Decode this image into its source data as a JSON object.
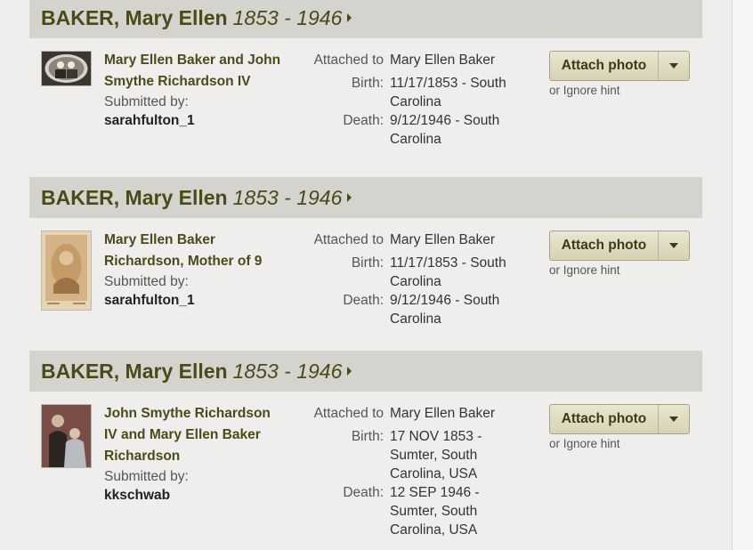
{
  "records": [
    {
      "name": "BAKER, Mary Ellen",
      "dates": "1853 - 1946",
      "photo_title": "Mary Ellen Baker and John Smythe Richardson IV",
      "submitted_label": "Submitted by:",
      "submitter": "sarahfulton_1",
      "attached_label": "Attached to",
      "attached_to": "Mary Ellen Baker",
      "birth_label": "Birth:",
      "birth": "11/17/1853 - South Carolina",
      "death_label": "Death:",
      "death": "9/12/1946 - South Carolina",
      "attach_button": "Attach photo",
      "ignore_link": "or Ignore hint"
    },
    {
      "name": "BAKER, Mary Ellen",
      "dates": "1853 - 1946",
      "photo_title": "Mary Ellen Baker Richardson, Mother of 9",
      "submitted_label": "Submitted by:",
      "submitter": "sarahfulton_1",
      "attached_label": "Attached to",
      "attached_to": "Mary Ellen Baker",
      "birth_label": "Birth:",
      "birth": "11/17/1853 - South Carolina",
      "death_label": "Death:",
      "death": "9/12/1946 - South Carolina",
      "attach_button": "Attach photo",
      "ignore_link": "or Ignore hint"
    },
    {
      "name": "BAKER, Mary Ellen",
      "dates": "1853 - 1946",
      "photo_title": "John Smythe Richardson IV and Mary Ellen Baker Richardson",
      "submitted_label": "Submitted by:",
      "submitter": "kkschwab",
      "attached_label": "Attached to",
      "attached_to": "Mary Ellen Baker",
      "birth_label": "Birth:",
      "birth": "17 NOV 1853 - Sumter, South Carolina, USA",
      "death_label": "Death:",
      "death": "12 SEP 1946 - Sumter, South Carolina, USA",
      "attach_button": "Attach photo",
      "ignore_link": "or Ignore hint"
    }
  ],
  "colors": {
    "header_bg": "#d5d3ce",
    "title_text": "#4a4b19",
    "button_bg": "#ddd8bc"
  }
}
